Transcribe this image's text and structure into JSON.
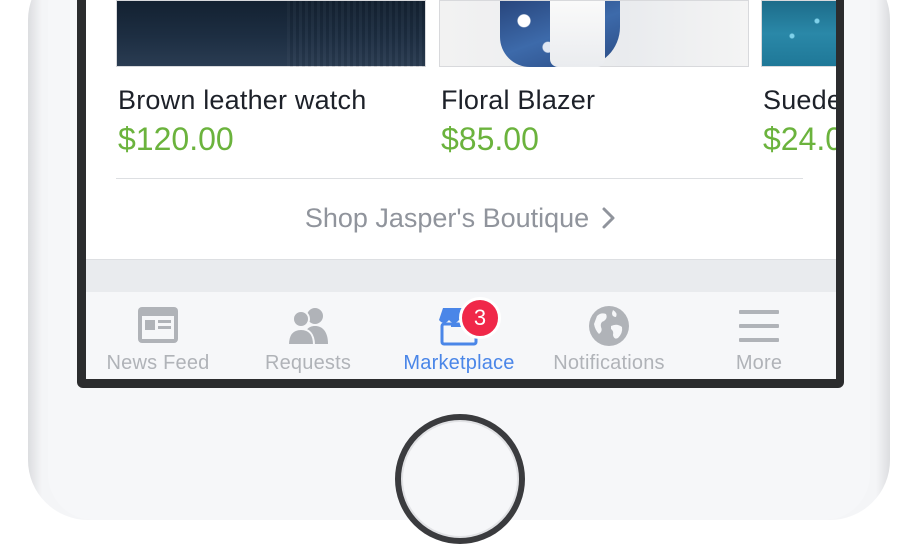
{
  "products": [
    {
      "title": "Brown leather watch",
      "price": "$120.00"
    },
    {
      "title": "Floral Blazer",
      "price": "$85.00"
    },
    {
      "title": "Suede",
      "price": "$24.0"
    }
  ],
  "shop_link": {
    "label": "Shop Jasper's Boutique",
    "icon": "chevron-right-icon"
  },
  "tab_bar": {
    "tabs": [
      {
        "label": "News Feed",
        "icon": "news-feed-icon"
      },
      {
        "label": "Requests",
        "icon": "friend-requests-icon"
      },
      {
        "label": "Marketplace",
        "icon": "marketplace-store-icon",
        "active": true,
        "badge": "3"
      },
      {
        "label": "Notifications",
        "icon": "globe-icon"
      },
      {
        "label": "More",
        "icon": "hamburger-menu-icon"
      }
    ]
  },
  "colors": {
    "price": "#6bb33d",
    "active_tab": "#4a86e8",
    "inactive_tab": "#b0b3b8",
    "badge": "#f02849",
    "link_text": "#90949c"
  }
}
